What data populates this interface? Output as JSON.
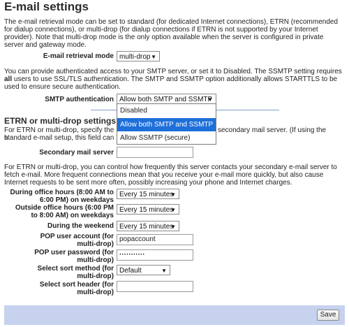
{
  "title": "E-mail settings",
  "intro": "The e-mail retrieval mode can be set to standard (for dedicated Internet connections), ETRN (recommended for dialup connections), or multi-drop (for dialup connections if ETRN is not supported by your Internet provider). Note that multi-drop mode is the only option available when the server is configured in private server and gateway mode.",
  "retrieval": {
    "label": "E-mail retrieval mode",
    "value": "multi-drop"
  },
  "ssmtp_text_pre": "You can provide authenticated access to your SMTP server, or set it to Disabled. The SSMTP setting requires ",
  "ssmtp_text_bold": "all",
  "ssmtp_text_post": " users to use SSL/TLS authentication. The SMTP and SSMTP option additionally allows STARTTLS to be used to ensure secure authentication.",
  "smtp_auth": {
    "label": "SMTP authentication",
    "value": "Allow both SMTP and SSMTP",
    "options": [
      "Disabled",
      "Allow both SMTP and SSMTP",
      "Allow SSMTP (secure)"
    ]
  },
  "etrn_heading": "ETRN or multi-drop settings",
  "etrn_text_left": "For ETRN or multi-drop, specify the h",
  "etrn_text_right": "secondary mail server. (If using the",
  "etrn_text_line2": "standard e-mail setup, this field can",
  "secondary_server": {
    "label": "Secondary mail server",
    "value": ""
  },
  "freq_text": "For ETRN or multi-drop, you can control how frequently this server contacts your secondary e-mail server to fetch e-mail. More frequent connections mean that you receive your e-mail more quickly, but also cause Internet requests to be sent more often, possibly increasing your phone and Internet charges.",
  "office_hours": {
    "label": "During office hours (8:00 AM to 6:00 PM) on weekdays",
    "value": "Every 15 minutes"
  },
  "outside_hours": {
    "label": "Outside office hours (6:00 PM to 8:00 AM) on weekdays",
    "value": "Every 15 minutes"
  },
  "weekend": {
    "label": "During the weekend",
    "value": "Every 15 minutes"
  },
  "pop_account": {
    "label": "POP user account (for multi-drop)",
    "value": "popaccount"
  },
  "pop_password": {
    "label": "POP user password (for multi-drop)",
    "value": "···········"
  },
  "sort_method": {
    "label": "Select sort method (for multi-drop)",
    "value": "Default"
  },
  "sort_header": {
    "label": "Select sort header (for multi-drop)",
    "value": ""
  },
  "save_label": "Save"
}
